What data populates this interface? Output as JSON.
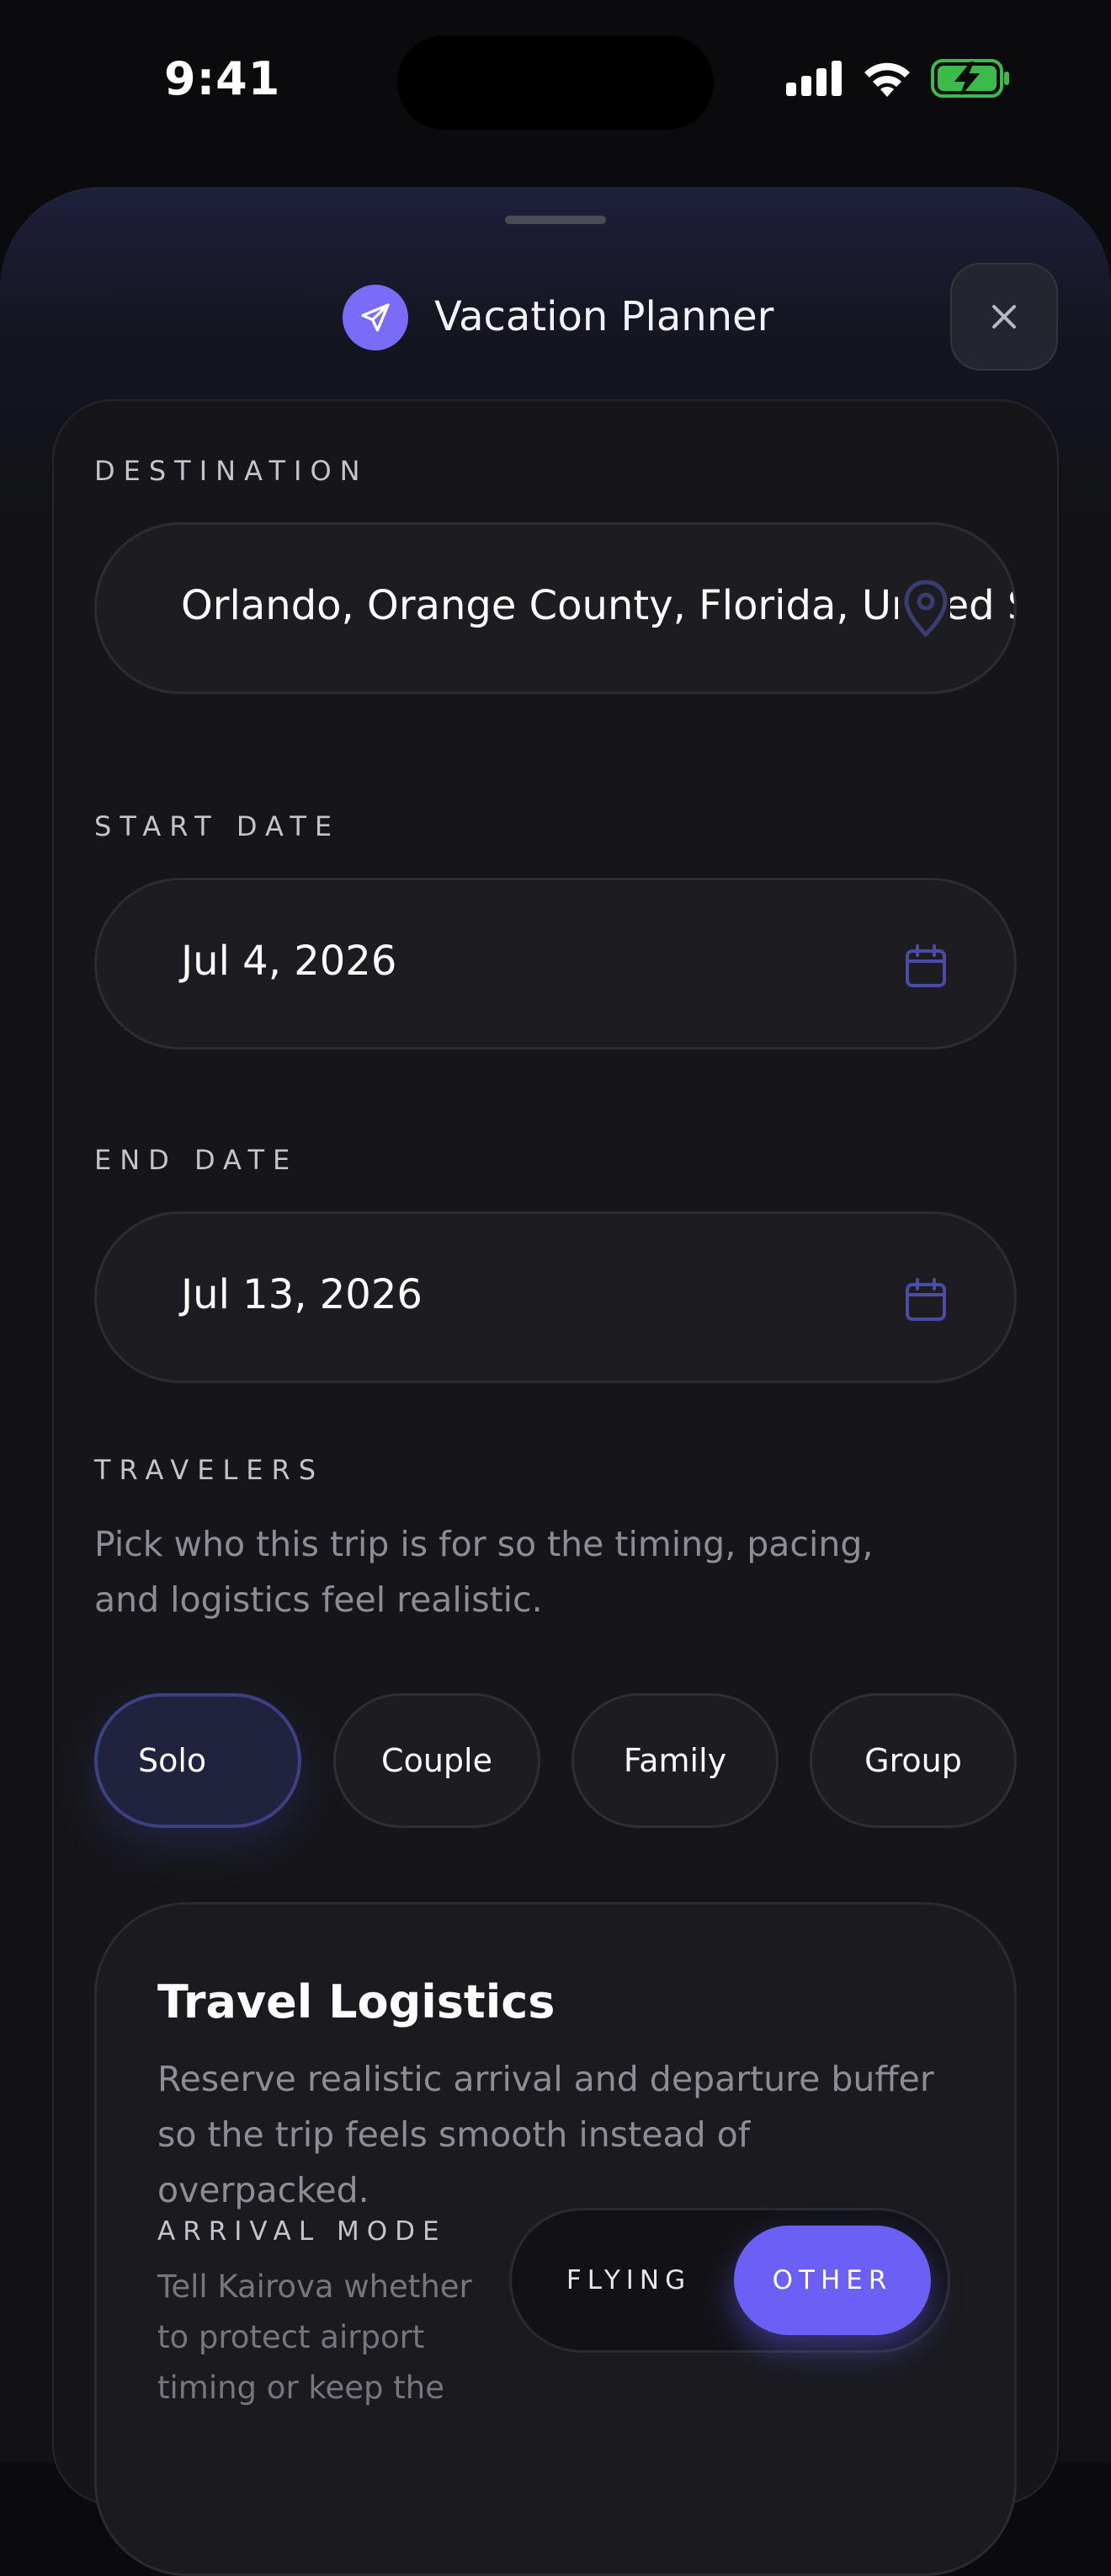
{
  "status_bar": {
    "time": "9:41"
  },
  "header": {
    "title": "Vacation Planner",
    "icon": "plane-icon",
    "accent": "#7a6cf6"
  },
  "destination": {
    "label": "DESTINATION",
    "value": "Orlando, Orange County, Florida, United States"
  },
  "start_date": {
    "label": "START DATE",
    "value": "Jul 4, 2026"
  },
  "end_date": {
    "label": "END DATE",
    "value": "Jul 13, 2026"
  },
  "travelers": {
    "label": "TRAVELERS",
    "description": "Pick who this trip is for so the timing, pacing, and logistics feel realistic.",
    "options": [
      "Solo",
      "Couple",
      "Family",
      "Group"
    ],
    "selected": "Solo"
  },
  "logistics": {
    "title": "Travel Logistics",
    "description": "Reserve realistic arrival and departure buffer so the trip feels smooth instead of overpacked.",
    "arrival_mode_label": "ARRIVAL MODE",
    "arrival_mode_description": "Tell Kairova whether to protect airport timing or keep the",
    "modes": [
      "FLYING",
      "OTHER"
    ],
    "selected_mode": "OTHER"
  }
}
